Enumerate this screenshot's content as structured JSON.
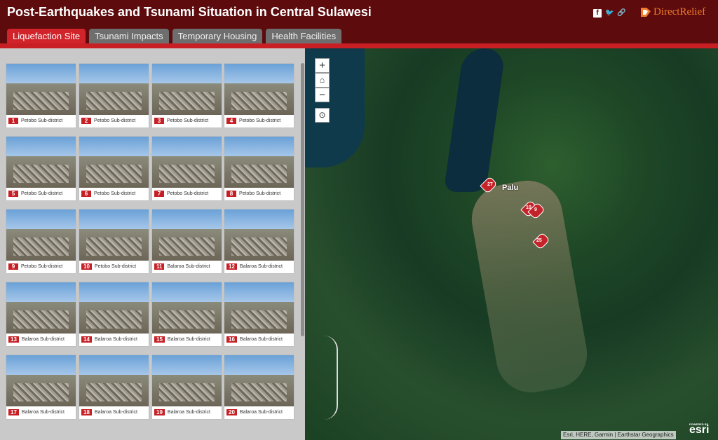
{
  "header": {
    "title": "Post-Earthquakes and Tsunami Situation in Central Sulawesi",
    "logo_text": "DirectRelief"
  },
  "social": {
    "icons": [
      "facebook-icon",
      "twitter-icon",
      "link-icon"
    ]
  },
  "tabs": [
    {
      "label": "Liquefaction Site",
      "active": true
    },
    {
      "label": "Tsunami Impacts",
      "active": false
    },
    {
      "label": "Temporary Housing",
      "active": false
    },
    {
      "label": "Health Facilities",
      "active": false
    }
  ],
  "gallery": [
    {
      "number": "1",
      "label": "Petobo Sub-district"
    },
    {
      "number": "2",
      "label": "Petobo Sub-district"
    },
    {
      "number": "3",
      "label": "Petobo Sub-district"
    },
    {
      "number": "4",
      "label": "Petobo Sub-district"
    },
    {
      "number": "5",
      "label": "Petobo Sub-district"
    },
    {
      "number": "6",
      "label": "Petobo Sub-district"
    },
    {
      "number": "7",
      "label": "Petobo Sub-district"
    },
    {
      "number": "8",
      "label": "Petobo Sub-district"
    },
    {
      "number": "9",
      "label": "Petobo Sub-district"
    },
    {
      "number": "10",
      "label": "Petobo Sub-district"
    },
    {
      "number": "11",
      "label": "Balaroa Sub-district"
    },
    {
      "number": "12",
      "label": "Balaroa Sub-district"
    },
    {
      "number": "13",
      "label": "Balaroa Sub-district"
    },
    {
      "number": "14",
      "label": "Balaroa Sub-district"
    },
    {
      "number": "15",
      "label": "Balaroa Sub-district"
    },
    {
      "number": "16",
      "label": "Balaroa Sub-district"
    },
    {
      "number": "17",
      "label": "Balaroa Sub-district"
    },
    {
      "number": "18",
      "label": "Balaroa Sub-district"
    },
    {
      "number": "19",
      "label": "Balaroa Sub-district"
    },
    {
      "number": "20",
      "label": "Balaroa Sub-district"
    }
  ],
  "map": {
    "controls": {
      "zoom_in": "+",
      "zoom_out": "−"
    },
    "city_label": "Palu",
    "markers": [
      "27",
      "10",
      "9",
      "25"
    ],
    "attribution": "Esri, HERE, Garmin | Earthstar Geographics",
    "powered_by": "POWERED BY",
    "esri_logo": "esri"
  }
}
